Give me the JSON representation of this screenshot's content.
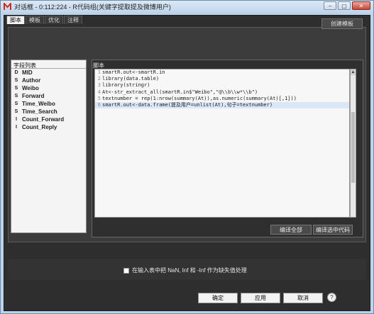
{
  "window": {
    "title": "对话框 - 0:112:224 - R代码组(关键字提取提及微博用户)",
    "brand_color": "#d12a1f"
  },
  "tabs": [
    {
      "label": "脚本",
      "active": true
    },
    {
      "label": "模板",
      "active": false
    },
    {
      "label": "优化",
      "active": false
    },
    {
      "label": "注释",
      "active": false
    }
  ],
  "toolbar": {
    "create_template_label": "创建模板"
  },
  "fields": {
    "header": "字段列表",
    "items": [
      {
        "type": "D",
        "label": "MID"
      },
      {
        "type": "S",
        "label": "Author"
      },
      {
        "type": "S",
        "label": "Weibo"
      },
      {
        "type": "S",
        "label": "Forward"
      },
      {
        "type": "S",
        "label": "Time_Weibo"
      },
      {
        "type": "S",
        "label": "Time_Search"
      },
      {
        "type": "I",
        "label": "Count_Forward"
      },
      {
        "type": "I",
        "label": "Count_Reply"
      }
    ]
  },
  "script": {
    "header": "脚本",
    "lines": [
      {
        "no": "1",
        "text": "smartR.out<-smartR.in"
      },
      {
        "no": "2",
        "text": "library(data.table)"
      },
      {
        "no": "3",
        "text": "library(stringr)"
      },
      {
        "no": "4",
        "text": "At<-str_extract_all(smartR.in$\"Weibo\",\"@\\\\b\\\\w*\\\\b\")"
      },
      {
        "no": "5",
        "text": "textnumber = rep(1:nrow(summary(At)),as.numeric(summary(At)[,1]))"
      },
      {
        "no": "6",
        "text": "smartR.out<-data.frame(提及用户=unlist(At),句子=textnumber)"
      }
    ]
  },
  "actions": {
    "compile_all": "编译全部",
    "compile_selected": "编译选中代码"
  },
  "options": {
    "na_checkbox_label": "在输入表中把 NaN, Inf 和 -Inf 作为缺失值处理",
    "na_checked": false
  },
  "footer": {
    "ok": "确定",
    "apply": "应用",
    "cancel": "取消",
    "help": "?"
  }
}
